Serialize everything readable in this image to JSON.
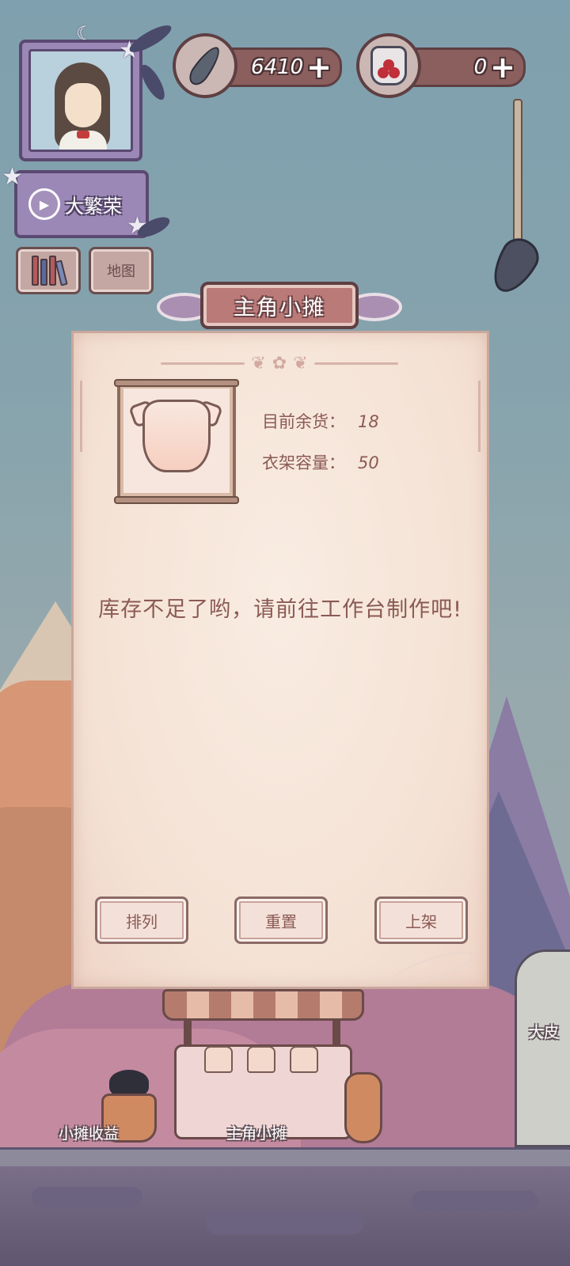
{
  "hud": {
    "video_button_label": "大繁荣",
    "map_button_label": "地图",
    "currency_feather": {
      "value": "6410",
      "plus": "+"
    },
    "currency_berries": {
      "value": "0",
      "plus": "+"
    }
  },
  "modal": {
    "title": "主角小摊",
    "stock_label": "目前余货：",
    "stock_value": "18",
    "capacity_label": "衣架容量：",
    "capacity_value": "50",
    "message": "库存不足了哟，请前往工作台制作吧!",
    "buttons": {
      "arrange": "排列",
      "reset": "重置",
      "list": "上架"
    }
  },
  "world": {
    "income_label": "小摊收益",
    "stall_label": "主角小摊",
    "npc_label": "大皮"
  },
  "colors": {
    "sky": "#86a3ad",
    "panel_bg": "#f4e1d4",
    "accent_text": "#8b5a55",
    "title_bg": "#b97a78",
    "hud_purple": "#9c88b6"
  }
}
